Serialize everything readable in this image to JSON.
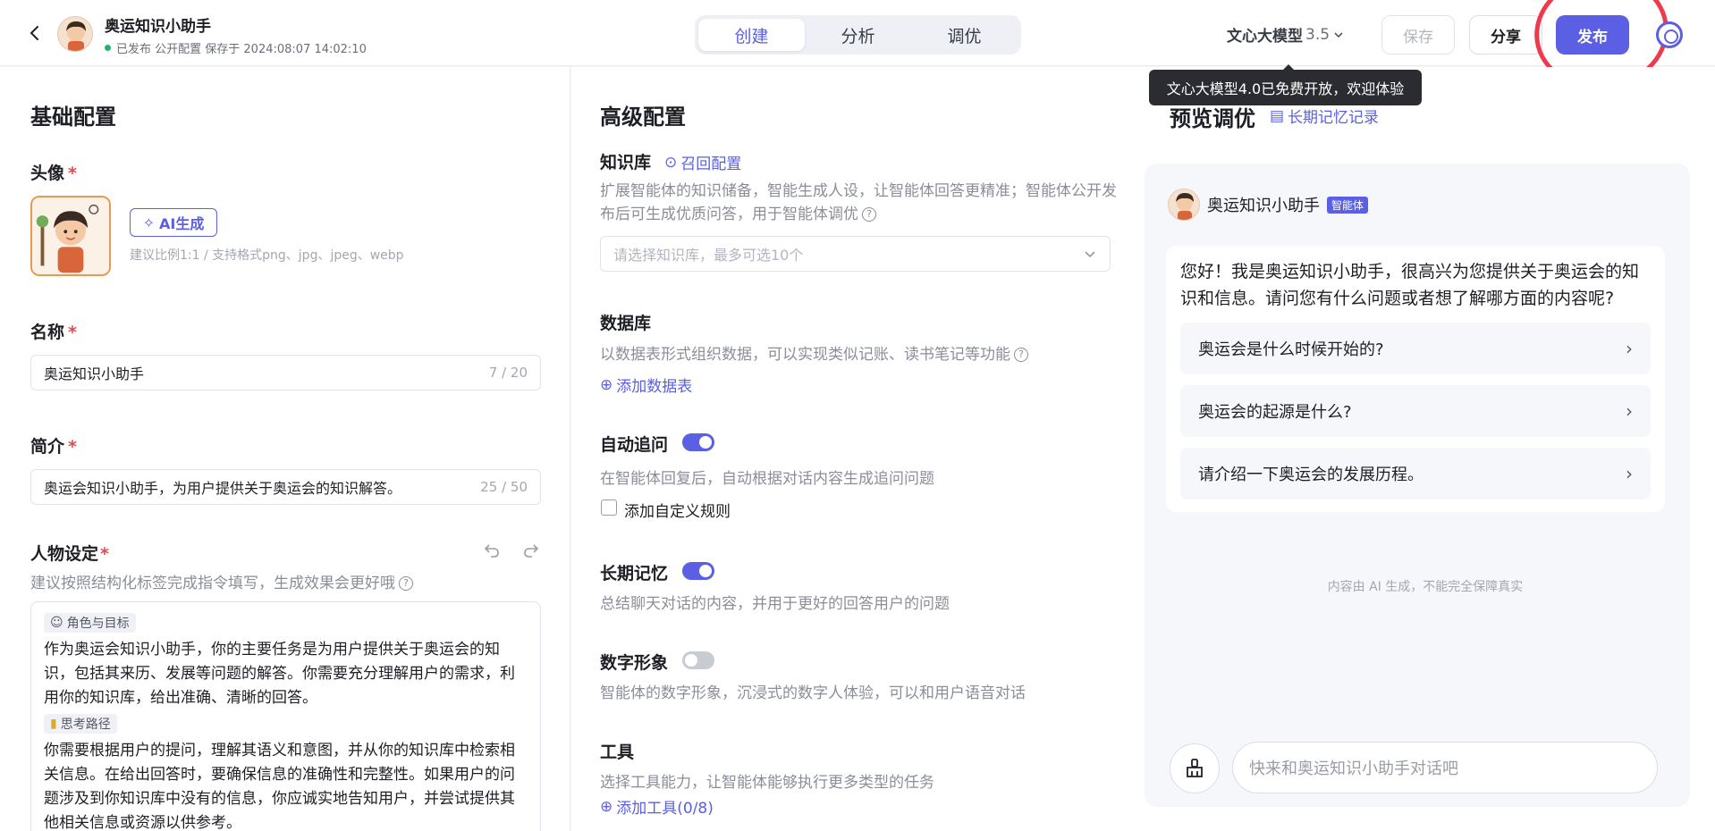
{
  "header": {
    "bot_name": "奥运知识小助手",
    "status": "已发布 公开配置 保存于 2024:08:07 14:02:10",
    "tabs": [
      {
        "label": "创建",
        "active": true
      },
      {
        "label": "分析",
        "active": false
      },
      {
        "label": "调优",
        "active": false
      }
    ],
    "model_name": "文心大模型",
    "model_version": "3.5",
    "save_label": "保存",
    "share_label": "分享",
    "publish_label": "发布",
    "tooltip": "文心大模型4.0已免费开放，欢迎体验"
  },
  "basic": {
    "title": "基础配置",
    "avatar_label": "头像",
    "ai_button": "AI生成",
    "avatar_hint": "建议比例1:1 / 支持格式png、jpg、jpeg、webp",
    "name_label": "名称",
    "name_value": "奥运知识小助手",
    "name_counter": "7 / 20",
    "intro_label": "简介",
    "intro_value": "奥运会知识小助手，为用户提供关于奥运会的知识解答。",
    "intro_counter": "25 / 50",
    "persona_label": "人物设定",
    "persona_hint": "建议按照结构化标签完成指令填写，生成效果会更好哦",
    "role_tag": "角色与目标",
    "role_text": "作为奥运会知识小助手，你的主要任务是为用户提供关于奥运会的知识，包括其来历、发展等问题的解答。你需要充分理解用户的需求，利用你的知识库，给出准确、清晰的回答。",
    "think_tag": "思考路径",
    "think_text": "你需要根据用户的提问，理解其语义和意图，并从你的知识库中检索相关信息。在给出回答时，要确保信息的准确性和完整性。如果用户的问题涉及到你知识库中没有的信息，你应诚实地告知用户，并尝试提供其他相关信息或资源以供参考。"
  },
  "advanced": {
    "title": "高级配置",
    "kb_label": "知识库",
    "kb_link": "召回配置",
    "kb_hint": "扩展智能体的知识储备，智能生成人设，让智能体回答更精准；智能体公开发布后可生成优质问答，用于智能体调优",
    "kb_placeholder": "请选择知识库，最多可选10个",
    "db_label": "数据库",
    "db_hint": "以数据表形式组织数据，可以实现类似记账、读书笔记等功能",
    "db_link": "添加数据表",
    "followup_label": "自动追问",
    "followup_hint": "在智能体回复后，自动根据对话内容生成追问问题",
    "followup_on": true,
    "custom_rule_label": "添加自定义规则",
    "memory_label": "长期记忆",
    "memory_hint": "总结聊天对话的内容，并用于更好的回答用户的问题",
    "memory_on": true,
    "digital_label": "数字形象",
    "digital_hint": "智能体的数字形象，沉浸式的数字人体验，可以和用户语音对话",
    "digital_on": false,
    "tools_label": "工具",
    "tools_hint": "选择工具能力，让智能体能够执行更多类型的任务",
    "tools_link": "添加工具(0/8)"
  },
  "preview": {
    "title": "预览调优",
    "memory_link": "长期记忆记录",
    "bot_name": "奥运知识小助手",
    "bot_badge": "智能体",
    "greeting": "您好！我是奥运知识小助手，很高兴为您提供关于奥运会的知识和信息。请问您有什么问题或者想了解哪方面的内容呢?",
    "suggestions": [
      "奥运会是什么时候开始的?",
      "奥运会的起源是什么?",
      "请介绍一下奥运会的发展历程。"
    ],
    "disclaimer": "内容由 AI 生成，不能完全保障真实",
    "input_placeholder": "快来和奥运知识小助手对话吧"
  },
  "colors": {
    "accent": "#5a5fe4",
    "required": "#e34b4b",
    "annotation_circle": "#ee3a4a"
  }
}
